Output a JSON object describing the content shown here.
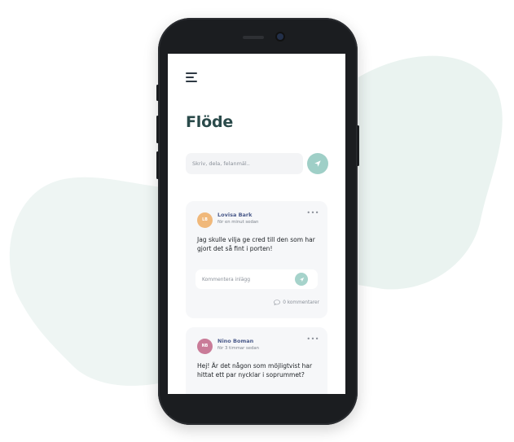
{
  "colors": {
    "accent": "#9fcfc7",
    "title": "#2a4a4a",
    "author": "#4a5a8a",
    "blob": "#e9f3f0",
    "phone": "#1b1d20"
  },
  "header": {
    "menu_icon": "hamburger-menu-icon",
    "title": "Flöde"
  },
  "composer": {
    "placeholder": "Skriv, dela, felanmäl..",
    "send_icon": "send-icon"
  },
  "posts": [
    {
      "initials": "LB",
      "avatar_color": "#f0b87a",
      "author": "Lovisa Bark",
      "time": "för en minut sedan",
      "text": "Jag skulle vilja ge cred till den som har gjort det så fint i porten!",
      "comment_placeholder": "Kommentera inlägg",
      "comments_label": "0 kommentarer"
    },
    {
      "initials": "NB",
      "avatar_color": "#c97b98",
      "author": "Nino Boman",
      "time": "för 3 timmar sedan",
      "text": "Hej! Är det någon som möjligtvist har hittat ett par nycklar i soprummet?"
    }
  ]
}
